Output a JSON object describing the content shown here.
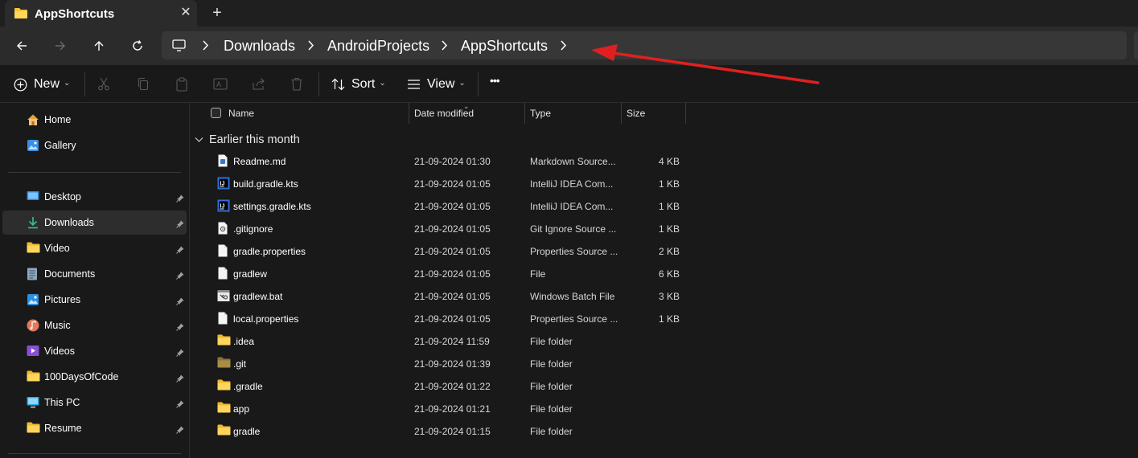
{
  "tab": {
    "title": "AppShortcuts",
    "close_glyph": "✕",
    "new_glyph": "+"
  },
  "nav": {
    "breadcrumbs": [
      "Downloads",
      "AndroidProjects",
      "AppShortcuts"
    ]
  },
  "toolbar": {
    "new_label": "New",
    "sort_label": "Sort",
    "view_label": "View",
    "more_glyph": "•••"
  },
  "sidebar": {
    "top_items": [
      {
        "label": "Home",
        "icon": "home-icon"
      },
      {
        "label": "Gallery",
        "icon": "gallery-icon"
      }
    ],
    "pinned_items": [
      {
        "label": "Desktop",
        "icon": "desktop-icon"
      },
      {
        "label": "Downloads",
        "icon": "downloads-icon",
        "active": true
      },
      {
        "label": "Video",
        "icon": "folder-icon"
      },
      {
        "label": "Documents",
        "icon": "documents-icon"
      },
      {
        "label": "Pictures",
        "icon": "pictures-icon"
      },
      {
        "label": "Music",
        "icon": "music-icon"
      },
      {
        "label": "Videos",
        "icon": "videos-icon"
      },
      {
        "label": "100DaysOfCode",
        "icon": "folder-icon"
      },
      {
        "label": "This PC",
        "icon": "this-pc-icon"
      },
      {
        "label": "Resume",
        "icon": "folder-icon"
      }
    ]
  },
  "columns": {
    "name": "Name",
    "date": "Date modified",
    "type": "Type",
    "size": "Size"
  },
  "group": {
    "label": "Earlier this month"
  },
  "files": [
    {
      "name": "Readme.md",
      "date": "21-09-2024 01:30",
      "type": "Markdown Source...",
      "size": "4 KB",
      "icon": "markdown-file-icon"
    },
    {
      "name": "build.gradle.kts",
      "date": "21-09-2024 01:05",
      "type": "IntelliJ IDEA Com...",
      "size": "1 KB",
      "icon": "intellij-file-icon"
    },
    {
      "name": "settings.gradle.kts",
      "date": "21-09-2024 01:05",
      "type": "IntelliJ IDEA Com...",
      "size": "1 KB",
      "icon": "intellij-file-icon"
    },
    {
      "name": ".gitignore",
      "date": "21-09-2024 01:05",
      "type": "Git Ignore Source ...",
      "size": "1 KB",
      "icon": "gitignore-file-icon"
    },
    {
      "name": "gradle.properties",
      "date": "21-09-2024 01:05",
      "type": "Properties Source ...",
      "size": "2 KB",
      "icon": "file-icon"
    },
    {
      "name": "gradlew",
      "date": "21-09-2024 01:05",
      "type": "File",
      "size": "6 KB",
      "icon": "file-icon"
    },
    {
      "name": "gradlew.bat",
      "date": "21-09-2024 01:05",
      "type": "Windows Batch File",
      "size": "3 KB",
      "icon": "batch-file-icon"
    },
    {
      "name": "local.properties",
      "date": "21-09-2024 01:05",
      "type": "Properties Source ...",
      "size": "1 KB",
      "icon": "file-icon"
    },
    {
      "name": ".idea",
      "date": "21-09-2024 11:59",
      "type": "File folder",
      "size": "",
      "icon": "folder-icon"
    },
    {
      "name": ".git",
      "date": "21-09-2024 01:39",
      "type": "File folder",
      "size": "",
      "icon": "folder-dim-icon"
    },
    {
      "name": ".gradle",
      "date": "21-09-2024 01:22",
      "type": "File folder",
      "size": "",
      "icon": "folder-icon"
    },
    {
      "name": "app",
      "date": "21-09-2024 01:21",
      "type": "File folder",
      "size": "",
      "icon": "folder-icon"
    },
    {
      "name": "gradle",
      "date": "21-09-2024 01:15",
      "type": "File folder",
      "size": "",
      "icon": "folder-icon"
    }
  ],
  "colors": {
    "accent_folder": "#f7c23a",
    "annotation_arrow": "#e02020",
    "background": "#191919"
  }
}
